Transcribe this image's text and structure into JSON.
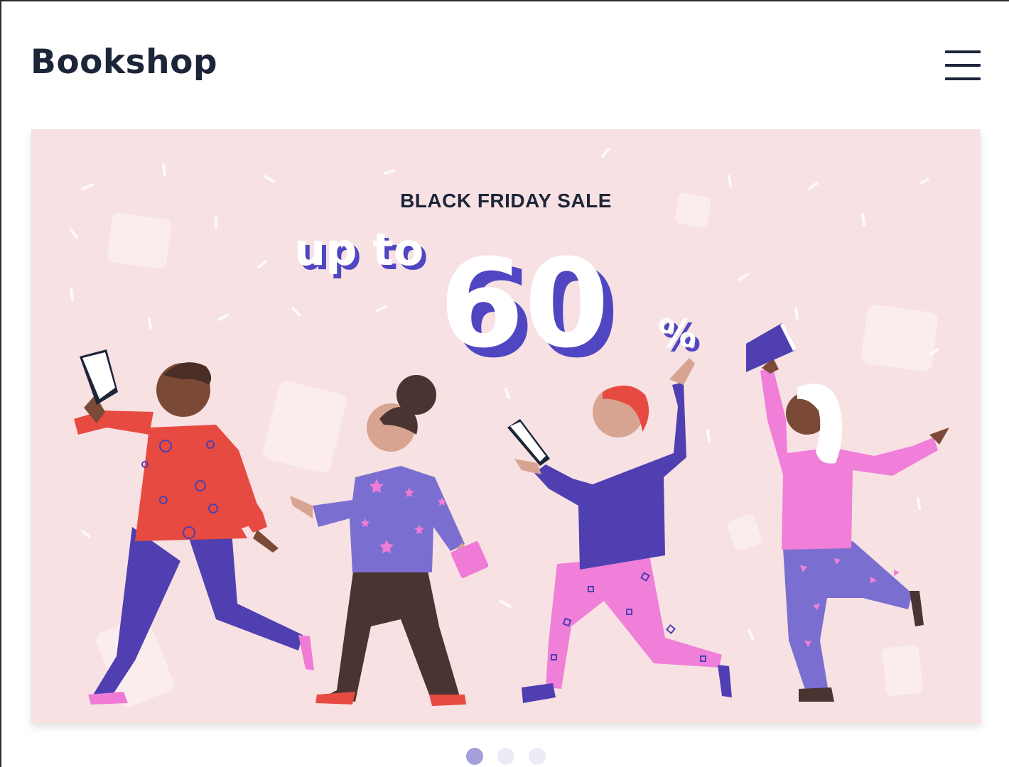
{
  "header": {
    "brand": "Bookshop",
    "menu_icon": "hamburger-menu-icon"
  },
  "banner": {
    "kicker": "BLACK FRIDAY SALE",
    "lead": "up to",
    "amount": "60",
    "unit": "%",
    "colors": {
      "background": "#f8e1e3",
      "accent": "#5046c2",
      "text": "#1d2538"
    }
  },
  "carousel": {
    "slides": 3,
    "active_slide": 1,
    "colors": {
      "active": "#a3a0dc",
      "inactive": "#ececf4"
    }
  }
}
